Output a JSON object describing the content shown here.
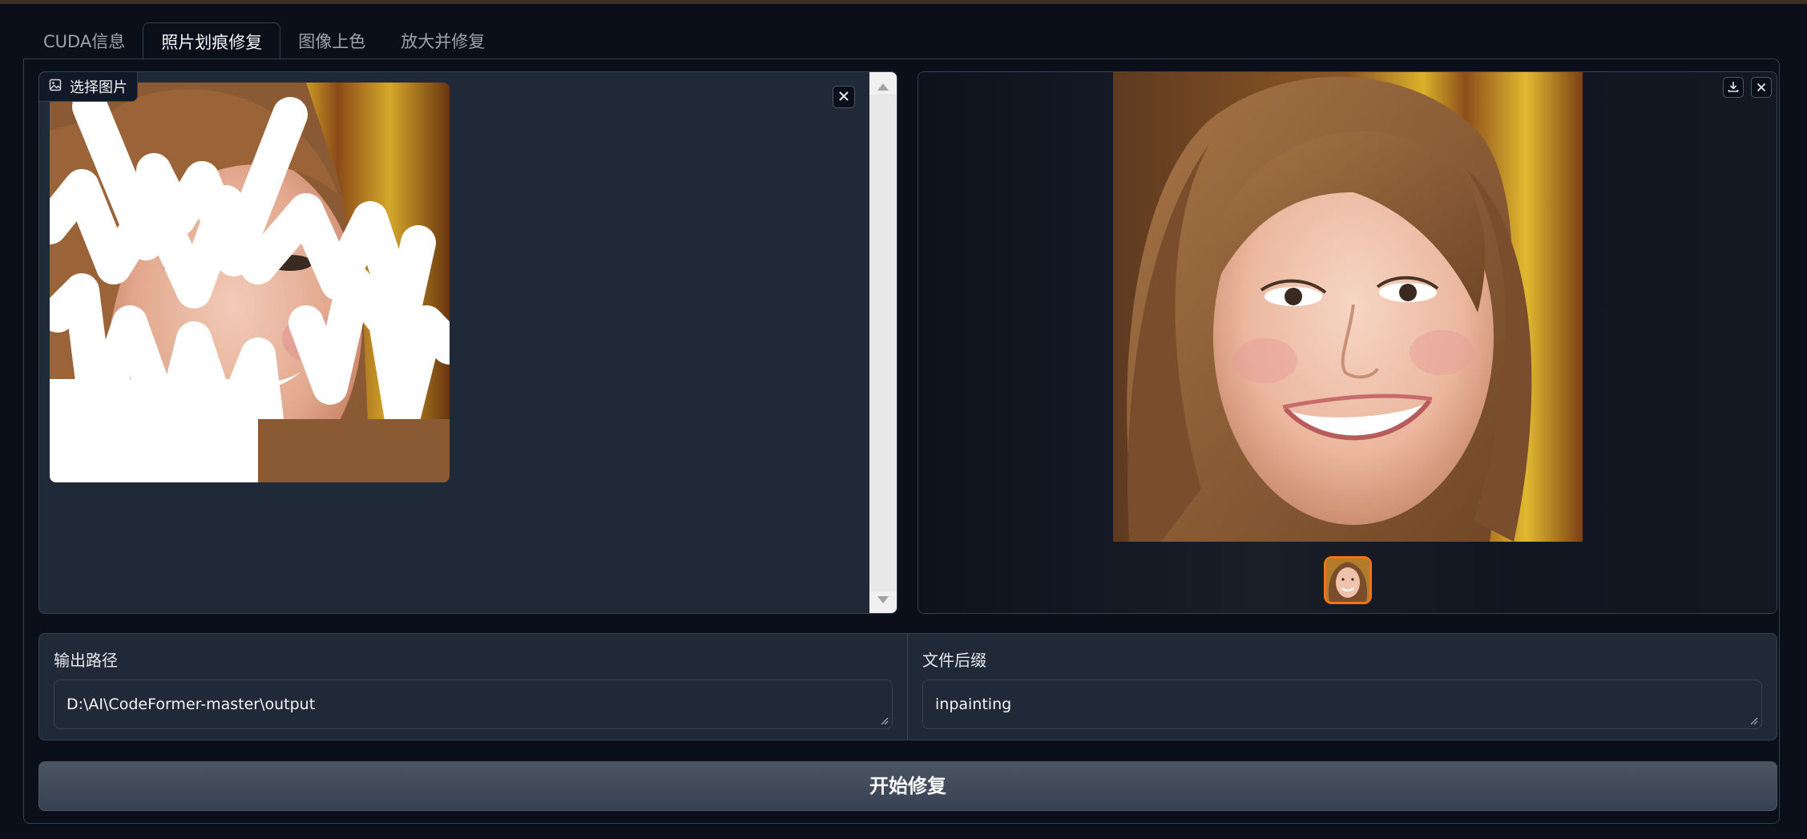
{
  "tabs": [
    {
      "label": "CUDA信息",
      "active": false
    },
    {
      "label": "照片划痕修复",
      "active": true
    },
    {
      "label": "图像上色",
      "active": false
    },
    {
      "label": "放大并修复",
      "active": false
    }
  ],
  "input_image": {
    "label": "选择图片",
    "icons": {
      "label_icon": "image-icon",
      "clear": "close-icon"
    }
  },
  "output_gallery": {
    "icons": {
      "download": "download-icon",
      "close": "close-icon"
    },
    "thumbnail_selected": true
  },
  "fields": {
    "output_path": {
      "label": "输出路径",
      "value": "D:\\AI\\CodeFormer-master\\output"
    },
    "file_suffix": {
      "label": "文件后缀",
      "value": "inpainting"
    }
  },
  "start_button": {
    "label": "开始修复"
  },
  "colors": {
    "background": "#0b0f19",
    "panel": "#1f2937",
    "border": "#374151",
    "accent": "#f97316"
  }
}
